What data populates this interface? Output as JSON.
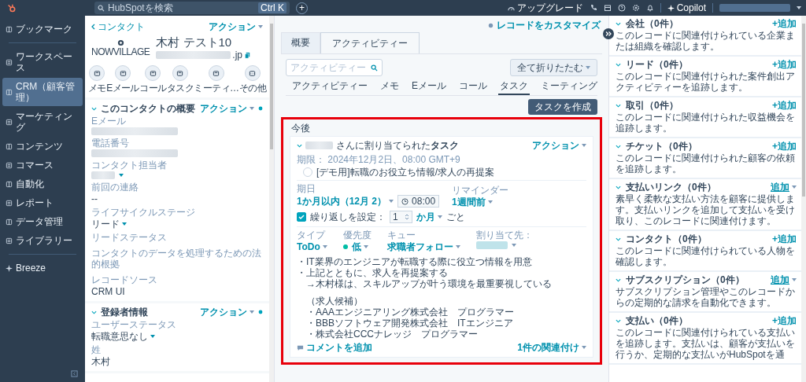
{
  "topbar": {
    "search_placeholder": "HubSpotを検索",
    "shortcut": "Ctrl K",
    "add": "+",
    "upgrade": "アップグレード",
    "copilot": "Copilot"
  },
  "nav": {
    "items": [
      {
        "label": "ブックマーク",
        "selected": false
      },
      {
        "label": "ワークスペース",
        "selected": false
      },
      {
        "label": "CRM（顧客管理）",
        "selected": true
      },
      {
        "label": "マーケティング",
        "selected": false
      },
      {
        "label": "コンテンツ",
        "selected": false
      },
      {
        "label": "コマース",
        "selected": false
      },
      {
        "label": "自動化",
        "selected": false
      },
      {
        "label": "レポート",
        "selected": false
      },
      {
        "label": "データ管理",
        "selected": false
      },
      {
        "label": "ライブラリー",
        "selected": false
      }
    ],
    "breeze": "Breeze"
  },
  "contact": {
    "back": "コンタクト",
    "actions": "アクション",
    "logo_text": "NOWVILLAGE",
    "name": "木村 テスト10",
    "email_suffix": ".jp",
    "quick_actions": [
      "メモ",
      "Eメール",
      "コール",
      "タスク",
      "ミーティ…",
      "その他"
    ],
    "sections": [
      {
        "title": "このコンタクトの概要",
        "actions": "アクション",
        "fields": [
          {
            "label": "Eメール",
            "kind": "redacted"
          },
          {
            "label": "電話番号",
            "kind": "redacted"
          },
          {
            "label": "コンタクト担当者",
            "kind": "redacted_dropdown"
          },
          {
            "label": "前回の連絡",
            "kind": "text",
            "value": "--"
          },
          {
            "label": "ライフサイクルステージ",
            "kind": "dropdown",
            "value": "リード"
          },
          {
            "label": "リードステータス",
            "kind": "empty"
          },
          {
            "label": "コンタクトのデータを処理するための法的根拠",
            "kind": "empty"
          },
          {
            "label": "レコードソース",
            "kind": "text",
            "value": "CRM UI"
          }
        ]
      },
      {
        "title": "登録者情報",
        "actions": "アクション",
        "fields": [
          {
            "label": "ユーザーステータス",
            "kind": "dropdown",
            "value": "転職意思なし"
          },
          {
            "label": "姓",
            "kind": "text",
            "value": "木村"
          }
        ]
      }
    ]
  },
  "activity": {
    "customize": "レコードをカスタマイズ",
    "tabs": [
      {
        "label": "概要",
        "selected": false
      },
      {
        "label": "アクティビティー",
        "selected": true
      }
    ],
    "search_placeholder": "アクティビティー",
    "collapse": "全て折りたたむ",
    "filters": [
      {
        "label": "アクティビティー",
        "selected": false
      },
      {
        "label": "メモ",
        "selected": false
      },
      {
        "label": "Eメール",
        "selected": false
      },
      {
        "label": "コール",
        "selected": false
      },
      {
        "label": "タスク",
        "selected": true
      },
      {
        "label": "ミーティング",
        "selected": false
      }
    ],
    "create": "タスクを作成",
    "group": "今後",
    "task": {
      "title": "さんに割り当てられた**タスク**",
      "actions": "アクション",
      "due": "期限： 2024年12月2日、08:00 GMT+9",
      "name": "[デモ用]転職のお役立ち情報/求人の再提案",
      "completed": false,
      "due_label": "期日",
      "due_value": "1か月以内（12月 2）",
      "time": "08:00",
      "reminder_label": "リマインダー",
      "reminder_value": "1週間前",
      "repeat": {
        "checked": true,
        "label": "繰り返しを設定：",
        "count": "1",
        "unit": "か月",
        "suffix": "ごと"
      },
      "props": [
        {
          "label": "タイプ",
          "value": "ToDo",
          "kind": "dropdown"
        },
        {
          "label": "優先度",
          "value": "低",
          "kind": "priority",
          "color": "#00bda5"
        },
        {
          "label": "キュー",
          "value": "求職者フォロー",
          "kind": "dropdown"
        },
        {
          "label": "割り当て先：",
          "kind": "redacted"
        }
      ],
      "notes": [
        [
          "・IT業界のエンジニアが転職する際に役立つ情報を用意",
          "・上記とともに、求人を再提案する",
          "　→木村様は、スキルアップが叶う環境を最重要視している"
        ],
        [
          "　（求人候補）",
          "　・AAAエンジニアリング株式会社　プログラマー",
          "　・BBBソフトウェア開発株式会社　ITエンジニア",
          "　・株式会社CCCナレッジ　プログラマー"
        ]
      ],
      "comment": "コメントを追加",
      "associations": "1件の関連付け"
    }
  },
  "associations": [
    {
      "title": "会社（0件）",
      "add": "+追加",
      "kind": "plus",
      "description": "このレコードに関連付けられている企業または組織を確認します。"
    },
    {
      "title": "リード（0件）",
      "add": "+追加",
      "kind": "plus",
      "description": "このレコードに関連付けられた案件創出アクティビティーを追跡します。"
    },
    {
      "title": "取引（0件）",
      "add": "+追加",
      "kind": "plus",
      "description": "このレコードに関連付けられた収益機会を追跡します。"
    },
    {
      "title": "チケット（0件）",
      "add": "+追加",
      "kind": "plus",
      "description": "このレコードに関連付けられた顧客の依頼を追跡します。"
    },
    {
      "title": "支払いリンク（0件）",
      "add": "追加",
      "kind": "dropdown",
      "description": "素早く柔軟な支払い方法を顧客に提供します。支払いリンクを追加して支払いを受け取り、このレコードに関連付けます。"
    },
    {
      "title": "コンタクト（0件）",
      "add": "+追加",
      "kind": "plus",
      "description": "このレコードに関連付けられている人物を確認します。"
    },
    {
      "title": "サブスクリプション（0件）",
      "add": "追加",
      "kind": "dropdown",
      "description": "サブスクリプション管理やこのレコードからの定期的な請求を自動化できます。"
    },
    {
      "title": "支払い（0件）",
      "add": "+追加",
      "kind": "plus",
      "description": "このレコードに関連付けられている支払いを追跡します。支払いは、顧客が支払いを行うか、定期的な支払いがHubSpotを通"
    }
  ]
}
